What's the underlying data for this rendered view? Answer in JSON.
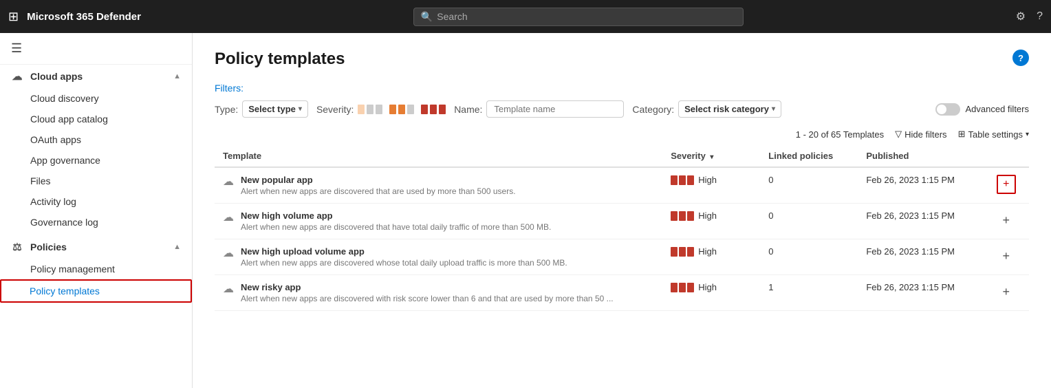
{
  "topbar": {
    "title": "Microsoft 365 Defender",
    "search_placeholder": "Search"
  },
  "sidebar": {
    "hamburger_icon": "☰",
    "cloud_apps_label": "Cloud apps",
    "items": [
      {
        "id": "cloud-discovery",
        "label": "Cloud discovery",
        "icon": "⊙"
      },
      {
        "id": "cloud-app-catalog",
        "label": "Cloud app catalog",
        "icon": "◫"
      },
      {
        "id": "oauth-apps",
        "label": "OAuth apps",
        "icon": "◎"
      },
      {
        "id": "app-governance",
        "label": "App governance",
        "icon": "⊕"
      },
      {
        "id": "files",
        "label": "Files",
        "icon": "☰"
      },
      {
        "id": "activity-log",
        "label": "Activity log",
        "icon": "◈"
      },
      {
        "id": "governance-log",
        "label": "Governance log",
        "icon": "≡"
      }
    ],
    "policies_label": "Policies",
    "policy_sub_items": [
      {
        "id": "policy-management",
        "label": "Policy management"
      },
      {
        "id": "policy-templates",
        "label": "Policy templates",
        "active": true
      }
    ]
  },
  "page": {
    "title": "Policy templates",
    "help_label": "?",
    "filters_label": "Filters:",
    "type_filter_label": "Type:",
    "type_filter_value": "Select type",
    "severity_filter_label": "Severity:",
    "name_filter_label": "Name:",
    "name_filter_placeholder": "Template name",
    "category_filter_label": "Category:",
    "category_filter_value": "Select risk category",
    "advanced_filters_label": "Advanced filters",
    "table_count": "1 - 20 of 65 Templates",
    "hide_filters_label": "Hide filters",
    "table_settings_label": "Table settings",
    "columns": [
      {
        "id": "template",
        "label": "Template",
        "sortable": false
      },
      {
        "id": "severity",
        "label": "Severity",
        "sortable": true
      },
      {
        "id": "linked-policies",
        "label": "Linked policies",
        "sortable": false
      },
      {
        "id": "published",
        "label": "Published",
        "sortable": false
      }
    ],
    "rows": [
      {
        "id": "row-1",
        "name": "New popular app",
        "description": "Alert when new apps are discovered that are used by more than 500 users.",
        "severity": "High",
        "linked_policies": "0",
        "published": "Feb 26, 2023 1:15 PM",
        "is_first": true
      },
      {
        "id": "row-2",
        "name": "New high volume app",
        "description": "Alert when new apps are discovered that have total daily traffic of more than 500 MB.",
        "severity": "High",
        "linked_policies": "0",
        "published": "Feb 26, 2023 1:15 PM",
        "is_first": false
      },
      {
        "id": "row-3",
        "name": "New high upload volume app",
        "description": "Alert when new apps are discovered whose total daily upload traffic is more than 500 MB.",
        "severity": "High",
        "linked_policies": "0",
        "published": "Feb 26, 2023 1:15 PM",
        "is_first": false
      },
      {
        "id": "row-4",
        "name": "New risky app",
        "description": "Alert when new apps are discovered with risk score lower than 6 and that are used by more than 50 ...",
        "severity": "High",
        "linked_policies": "1",
        "published": "Feb 26, 2023 1:15 PM",
        "is_first": false
      }
    ]
  }
}
